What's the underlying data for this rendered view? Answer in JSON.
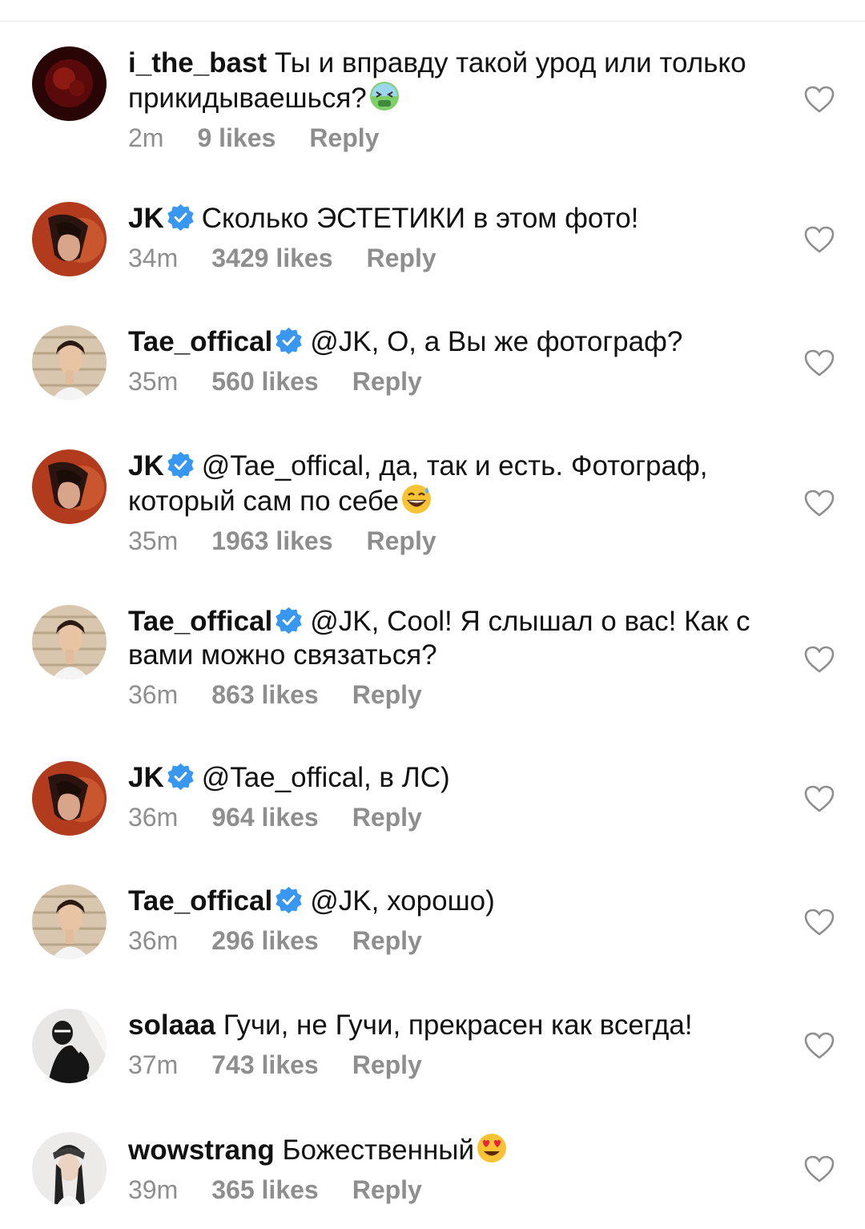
{
  "comments": [
    {
      "user": "i_the_bast",
      "verified": false,
      "text": "Ты и вправду такой урод или только прикидываешься?",
      "emoji": "nauseated-face",
      "time": "2m",
      "likes": "9 likes",
      "reply": "Reply",
      "avatar": "red"
    },
    {
      "user": "JK",
      "verified": true,
      "text": "Сколько ЭСТЕТИКИ в этом фото!",
      "emoji": null,
      "time": "34m",
      "likes": "3429 likes",
      "reply": "Reply",
      "avatar": "jk"
    },
    {
      "user": "Tae_offical",
      "verified": true,
      "text": "@JK, О, а Вы же фотограф?",
      "emoji": null,
      "time": "35m",
      "likes": "560 likes",
      "reply": "Reply",
      "avatar": "tae"
    },
    {
      "user": "JK",
      "verified": true,
      "text": "@Tae_offical, да, так и есть. Фотограф, который сам по себе",
      "emoji": "grinning-sweat",
      "time": "35m",
      "likes": "1963 likes",
      "reply": "Reply",
      "avatar": "jk"
    },
    {
      "user": "Tae_offical",
      "verified": true,
      "text": "@JK, Cool! Я слышал о вас! Как с вами можно связаться?",
      "emoji": null,
      "time": "36m",
      "likes": "863 likes",
      "reply": "Reply",
      "avatar": "tae"
    },
    {
      "user": "JK",
      "verified": true,
      "text": "@Tae_offical, в ЛС)",
      "emoji": null,
      "time": "36m",
      "likes": "964 likes",
      "reply": "Reply",
      "avatar": "jk"
    },
    {
      "user": "Tae_offical",
      "verified": true,
      "text": "@JK, хорошо)",
      "emoji": null,
      "time": "36m",
      "likes": "296 likes",
      "reply": "Reply",
      "avatar": "tae"
    },
    {
      "user": "solaaa",
      "verified": false,
      "text": "Гучи, не Гучи, прекрасен как всегда!",
      "emoji": null,
      "time": "37m",
      "likes": "743 likes",
      "reply": "Reply",
      "avatar": "sola"
    },
    {
      "user": "wowstrang",
      "verified": false,
      "text": "Божественный",
      "emoji": "heart-eyes",
      "time": "39m",
      "likes": "365 likes",
      "reply": "Reply",
      "avatar": "wow"
    }
  ],
  "colors": {
    "verified": "#3897f0",
    "meta": "#8e8e8e",
    "text": "#111111"
  }
}
